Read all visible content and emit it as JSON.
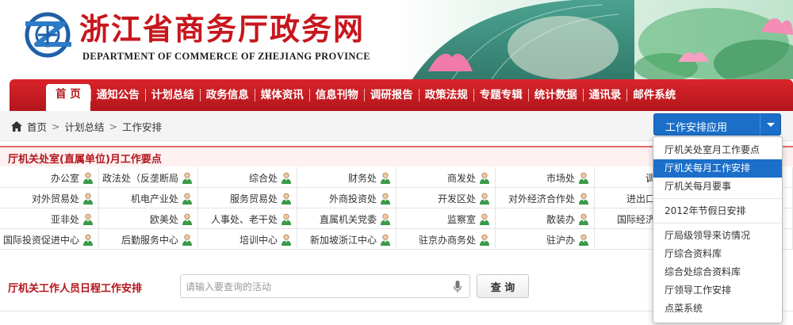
{
  "header": {
    "title": "浙江省商务厅政务网",
    "subtitle": "DEPARTMENT OF COMMERCE OF ZHEJIANG PROVINCE"
  },
  "nav": {
    "items": [
      {
        "label": "首 页",
        "active": true
      },
      {
        "label": "通知公告"
      },
      {
        "label": "计划总结"
      },
      {
        "label": "政务信息"
      },
      {
        "label": "媒体资讯"
      },
      {
        "label": "信息刊物"
      },
      {
        "label": "调研报告"
      },
      {
        "label": "政策法规"
      },
      {
        "label": "专题专辑"
      },
      {
        "label": "统计数据"
      },
      {
        "label": "通讯录"
      },
      {
        "label": "邮件系统"
      }
    ]
  },
  "breadcrumb": {
    "items": [
      "首页",
      "计划总结",
      "工作安排"
    ]
  },
  "app_select": {
    "label": "工作安排应用"
  },
  "section1": {
    "title": "厅机关处室(直属单位)月工作要点",
    "rows": [
      [
        "办公室",
        "政法处（反垄断局",
        "综合处",
        "财务处",
        "商发处",
        "市场处",
        "调节处",
        ""
      ],
      [
        "对外贸易处",
        "机电产业处",
        "服务贸易处",
        "外商投资处",
        "开发区处",
        "对外经济合作处",
        "进出口公平",
        ""
      ],
      [
        "亚非处",
        "欧美处",
        "人事处、老干处",
        "直属机关党委",
        "监察室",
        "散装办",
        "国际经济贸易",
        ""
      ],
      [
        "国际投资促进中心",
        "后勤服务中心",
        "培训中心",
        "新加坡浙江中心",
        "驻京办商务处",
        "驻沪办",
        "",
        ""
      ]
    ]
  },
  "section2": {
    "title": "厅机关工作人员日程工作安排",
    "search_placeholder": "请输入要查询的活动",
    "search_button": "查 询"
  },
  "dropdown": {
    "groups": [
      [
        "厅机关处室月工作要点",
        "厅机关每月工作安排",
        "厅机关每月要事"
      ],
      [
        "2012年节假日安排"
      ],
      [
        "厅局级领导来访情况",
        "厅综合资料库",
        "综合处综合资料库",
        "厅领导工作安排",
        "点菜系统"
      ]
    ],
    "active": "厅机关每月工作安排"
  },
  "colors": {
    "brand_red": "#c8161d",
    "nav_red": "#b3161c",
    "accent_blue": "#1b6fc9"
  }
}
